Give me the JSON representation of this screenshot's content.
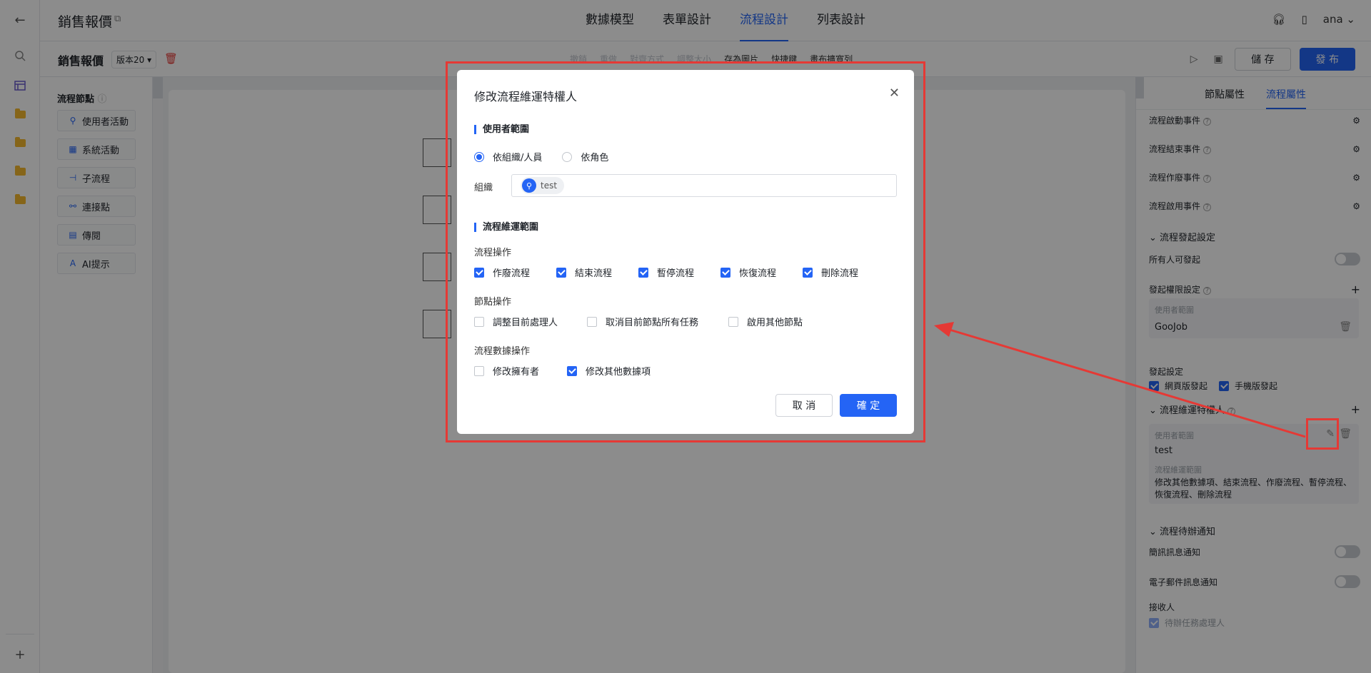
{
  "header": {
    "app_title": "銷售報價",
    "tabs": [
      "數據模型",
      "表單設計",
      "流程設計",
      "列表設計"
    ],
    "active_tab": "流程設計",
    "user": "ana"
  },
  "toolbar": {
    "process_title": "銷售報價",
    "version": "版本20",
    "actions": [
      "撤銷",
      "重做",
      "對齊方式",
      "調整大小",
      "存為圖片",
      "快捷鍵",
      "畫布擴寬列"
    ],
    "save_label": "儲 存",
    "publish_label": "發 布"
  },
  "nodes_panel": {
    "header": "流程節點",
    "items": [
      {
        "label": "使用者活動",
        "icon": "user-icon"
      },
      {
        "label": "系統活動",
        "icon": "grid-icon"
      },
      {
        "label": "子流程",
        "icon": "subflow-icon"
      },
      {
        "label": "連接點",
        "icon": "link-icon"
      },
      {
        "label": "傳閱",
        "icon": "circulate-icon"
      },
      {
        "label": "AI提示",
        "icon": "ai-icon"
      }
    ]
  },
  "right_panel": {
    "tabs": [
      "節點屬性",
      "流程屬性"
    ],
    "active_tab": "流程屬性",
    "events": [
      "流程啟動事件",
      "流程結束事件",
      "流程作廢事件",
      "流程啟用事件"
    ],
    "start_settings_header": "流程發起設定",
    "everyone_can_start": "所有人可發起",
    "start_permission": "發起權限設定",
    "user_scope_label": "使用者範圍",
    "start_scope_value": "GooJob",
    "launch_settings": "發起設定",
    "web_launch": "網頁版發起",
    "mobile_launch": "手機版發起",
    "maintainer_header": "流程維運特權人",
    "maintainer_scope_value": "test",
    "maintenance_scope_label": "流程維運範圍",
    "maintenance_scope_value": "修改其他數據項、結束流程、作廢流程、暫停流程、恢復流程、刪除流程",
    "pending_notify_header": "流程待辦通知",
    "sms_notify": "簡訊訊息通知",
    "email_notify": "電子郵件訊息通知",
    "recipients": "接收人",
    "recipient_option": "待辦任務處理人"
  },
  "modal": {
    "title": "修改流程維運特權人",
    "user_scope_section": "使用者範圍",
    "radio_org": "依組織/人員",
    "radio_role": "依角色",
    "org_label": "組織",
    "org_chip": "test",
    "maintenance_section": "流程維運範圍",
    "process_ops_label": "流程操作",
    "process_ops": [
      {
        "label": "作廢流程",
        "checked": true
      },
      {
        "label": "結束流程",
        "checked": true
      },
      {
        "label": "暫停流程",
        "checked": true
      },
      {
        "label": "恢復流程",
        "checked": true
      },
      {
        "label": "刪除流程",
        "checked": true
      }
    ],
    "node_ops_label": "節點操作",
    "node_ops": [
      {
        "label": "調整目前處理人",
        "checked": false
      },
      {
        "label": "取消目前節點所有任務",
        "checked": false
      },
      {
        "label": "啟用其他節點",
        "checked": false
      }
    ],
    "data_ops_label": "流程數據操作",
    "data_ops": [
      {
        "label": "修改擁有者",
        "checked": false
      },
      {
        "label": "修改其他數據項",
        "checked": true
      }
    ],
    "cancel_label": "取 消",
    "confirm_label": "確 定"
  },
  "colors": {
    "accent": "#2464f5",
    "annotation": "#e53935",
    "folder": "#f5b82e"
  }
}
